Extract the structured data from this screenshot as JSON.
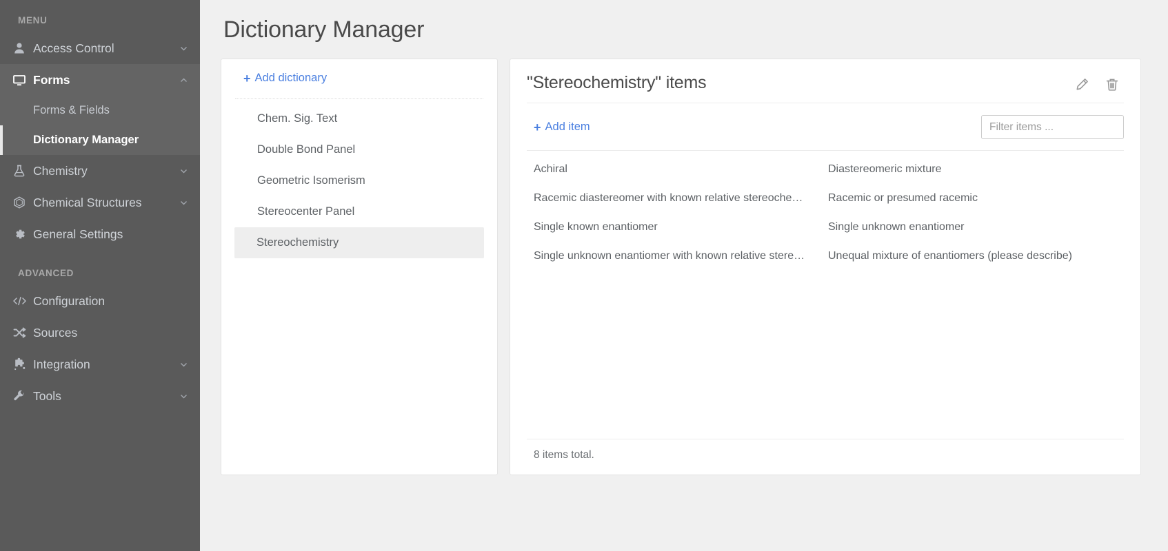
{
  "sidebar": {
    "menu_label": "MENU",
    "advanced_label": "ADVANCED",
    "items": [
      {
        "label": "Access Control",
        "icon": "user-icon",
        "chevron": "down",
        "expanded": false
      },
      {
        "label": "Forms",
        "icon": "monitor-icon",
        "chevron": "up",
        "expanded": true
      }
    ],
    "submenu": [
      {
        "label": "Forms & Fields",
        "active": false
      },
      {
        "label": "Dictionary Manager",
        "active": true
      }
    ],
    "items_after": [
      {
        "label": "Chemistry",
        "icon": "flask-icon",
        "chevron": "down"
      },
      {
        "label": "Chemical Structures",
        "icon": "hexagon-icon",
        "chevron": "down"
      },
      {
        "label": "General Settings",
        "icon": "gear-icon",
        "chevron": "none"
      }
    ],
    "advanced_items": [
      {
        "label": "Configuration",
        "icon": "code-icon",
        "chevron": "none"
      },
      {
        "label": "Sources",
        "icon": "shuffle-icon",
        "chevron": "none"
      },
      {
        "label": "Integration",
        "icon": "puzzle-icon",
        "chevron": "down"
      },
      {
        "label": "Tools",
        "icon": "wrench-icon",
        "chevron": "down"
      }
    ]
  },
  "page": {
    "title": "Dictionary Manager"
  },
  "dictionaries": {
    "add_label": "Add dictionary",
    "add_icon": "plus-icon",
    "list": [
      {
        "label": "Chem. Sig. Text",
        "selected": false
      },
      {
        "label": "Double Bond Panel",
        "selected": false
      },
      {
        "label": "Geometric Isomerism",
        "selected": false
      },
      {
        "label": "Stereocenter Panel",
        "selected": false
      },
      {
        "label": "Stereochemistry",
        "selected": true
      }
    ]
  },
  "items_panel": {
    "title": "\"Stereochemistry\" items",
    "edit_icon": "pencil-icon",
    "delete_icon": "trash-icon",
    "add_label": "Add item",
    "add_icon": "plus-icon",
    "filter_placeholder": "Filter items ...",
    "filter_value": "",
    "rows": [
      {
        "left": "Achiral",
        "right": "Diastereomeric mixture"
      },
      {
        "left": "Racemic diastereomer with known relative stereochemis…",
        "right": "Racemic or presumed racemic"
      },
      {
        "left": "Single known enantiomer",
        "right": "Single unknown enantiomer"
      },
      {
        "left": "Single unknown enantiomer with known relative stereoc…",
        "right": "Unequal mixture of enantiomers (please describe)"
      }
    ],
    "footer": "8 items total."
  },
  "colors": {
    "sidebar_bg": "#5a5a5a",
    "sidebar_expanded_bg": "#646464",
    "accent_link": "#4a7fe0",
    "page_bg": "#f0f0f0",
    "selected_row": "#eeeeee"
  }
}
